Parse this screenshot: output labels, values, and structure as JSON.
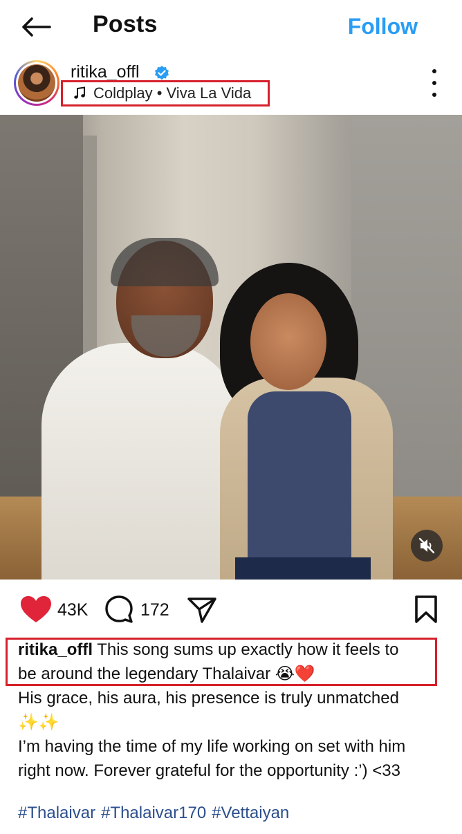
{
  "header": {
    "title": "Posts",
    "follow_label": "Follow"
  },
  "post": {
    "username": "ritika_offl",
    "music": "Coldplay • Viva La Vida",
    "likes": "43K",
    "comments": "172"
  },
  "caption": {
    "username": "ritika_offl",
    "line1": "This song sums up exactly how it feels to",
    "line2": "be around the legendary Thalaivar 😭❤️",
    "line3": "His grace, his aura, his presence is truly unmatched",
    "line4": "✨✨",
    "line5": "I’m having the time of my life working on set with him",
    "line6": "right now. Forever grateful for the opportunity :’) <33",
    "hashtags": [
      "#Thalaivar",
      "#Thalaivar170",
      "#Vettaiyan"
    ]
  },
  "colors": {
    "accent": "#2a9df4",
    "like": "#e0243a",
    "highlight_box": "#d6202b",
    "hashtag": "#2c4f8c"
  },
  "icons": [
    "back-arrow-icon",
    "verified-badge-icon",
    "music-note-icon",
    "more-options-icon",
    "mute-icon",
    "heart-icon",
    "comment-icon",
    "share-icon",
    "bookmark-icon"
  ]
}
